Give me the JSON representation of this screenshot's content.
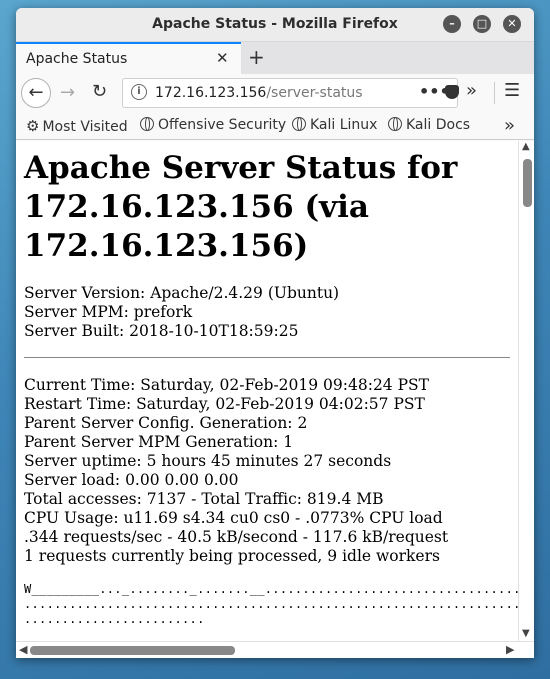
{
  "window": {
    "title": "Apache Status - Mozilla Firefox"
  },
  "tabs": [
    {
      "label": "Apache Status",
      "close": "✕"
    }
  ],
  "new_tab": "+",
  "nav": {
    "back": "←",
    "forward": "→",
    "reload": "↻",
    "url_host": "172.16.123.156",
    "url_path": "/server-status",
    "page_actions": "•••",
    "overflow": "»",
    "menu": "☰"
  },
  "bookmarks": [
    {
      "label": "Most Visited",
      "icon": "gear-icon"
    },
    {
      "label": "Offensive Security",
      "icon": "globe-icon"
    },
    {
      "label": "Kali Linux",
      "icon": "globe-icon"
    },
    {
      "label": "Kali Docs",
      "icon": "globe-icon"
    }
  ],
  "bookmarks_overflow": "»",
  "page": {
    "heading": "Apache Server Status for 172.16.123.156 (via 172.16.123.156)",
    "server_info": [
      "Server Version: Apache/2.4.29 (Ubuntu)",
      "Server MPM: prefork",
      "Server Built: 2018-10-10T18:59:25"
    ],
    "status": [
      "Current Time: Saturday, 02-Feb-2019 09:48:24 PST",
      "Restart Time: Saturday, 02-Feb-2019 04:02:57 PST",
      "Parent Server Config. Generation: 2",
      "Parent Server MPM Generation: 1",
      "Server uptime: 5 hours 45 minutes 27 seconds",
      "Server load: 0.00 0.00 0.00",
      "Total accesses: 7137 - Total Traffic: 819.4 MB",
      "CPU Usage: u11.69 s4.34 cu0 cs0 - .0773% CPU load",
      ".344 requests/sec - 40.5 kB/second - 117.6 kB/request",
      "1 requests currently being processed, 9 idle workers"
    ],
    "scoreboard": [
      "W_________..._........_.......__............................................",
      "............................................................................",
      "........................"
    ]
  }
}
